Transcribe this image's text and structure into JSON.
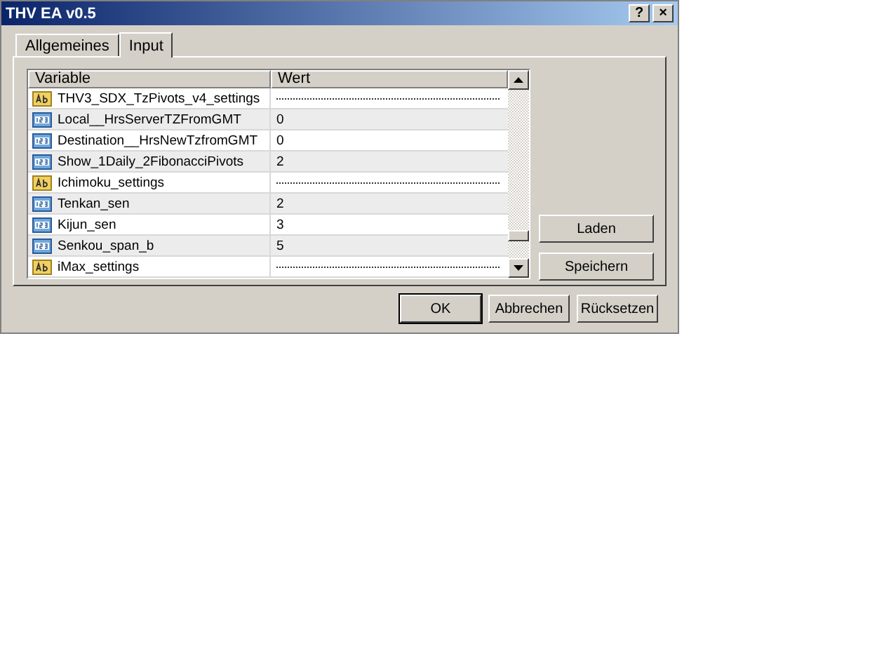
{
  "window": {
    "title": "THV EA v0.5",
    "help_button": "?",
    "close_button": "×"
  },
  "tabs": [
    {
      "label": "Allgemeines",
      "selected": false
    },
    {
      "label": "Input",
      "selected": true
    }
  ],
  "table": {
    "columns": [
      "Variable",
      "Wert"
    ],
    "rows": [
      {
        "kind": "string",
        "name": "THV3_SDX_TzPivots_v4_settings"
      },
      {
        "kind": "number",
        "name": "Local__HrsServerTZFromGMT",
        "value": "0"
      },
      {
        "kind": "number",
        "name": "Destination__HrsNewTzfromGMT",
        "value": "0"
      },
      {
        "kind": "number",
        "name": "Show_1Daily_2FibonacciPivots",
        "value": "2"
      },
      {
        "kind": "string",
        "name": "Ichimoku_settings"
      },
      {
        "kind": "number",
        "name": "Tenkan_sen",
        "value": "2"
      },
      {
        "kind": "number",
        "name": "Kijun_sen",
        "value": "3"
      },
      {
        "kind": "number",
        "name": "Senkou_span_b",
        "value": "5"
      },
      {
        "kind": "string",
        "name": "iMax_settings"
      }
    ]
  },
  "side_buttons": [
    "Laden",
    "Speichern"
  ],
  "buttons": [
    "OK",
    "Abbrechen",
    "Rücksetzen"
  ]
}
